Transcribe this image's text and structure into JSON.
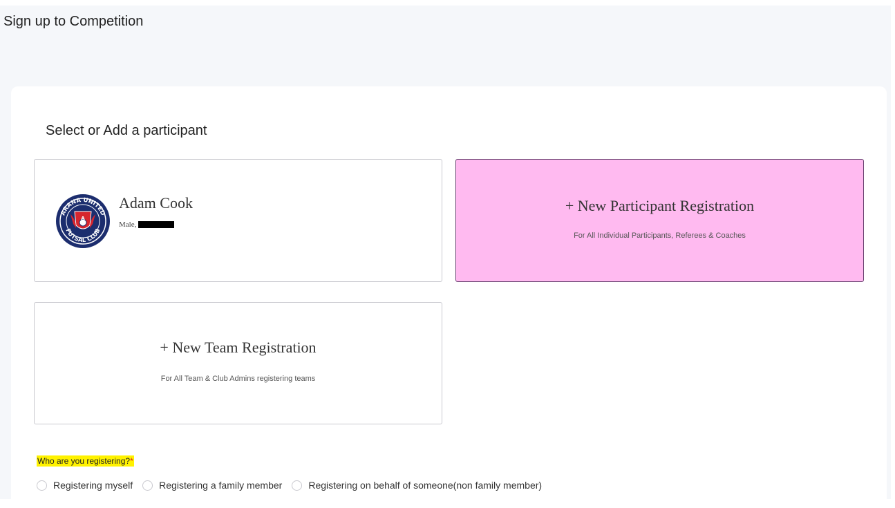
{
  "page": {
    "title": "Sign up to Competition"
  },
  "section": {
    "title": "Select or Add a participant"
  },
  "participant": {
    "name": "Adam Cook",
    "meta": "Male,",
    "avatar_icon": "arana-united-futsal-club-logo",
    "avatar_text": "ARANA UNITED FUTSAL CLUB"
  },
  "new_participant": {
    "heading": "+ New Participant Registration",
    "sub": "For All Individual Participants, Referees & Coaches"
  },
  "new_team": {
    "heading": "+ New Team Registration",
    "sub": "For All Team & Club Admins registering teams"
  },
  "question": {
    "label": "Who are you registering?",
    "required_mark": "*"
  },
  "options": [
    {
      "label": "Registering myself",
      "selected": false
    },
    {
      "label": "Registering a family member",
      "selected": false
    },
    {
      "label": "Registering on behalf of someone(non family member)",
      "selected": false
    }
  ],
  "colors": {
    "highlight_card": "#ffbaf0",
    "highlight_card_border": "#6b4472",
    "question_highlight": "#fff200",
    "required": "#e02020"
  }
}
